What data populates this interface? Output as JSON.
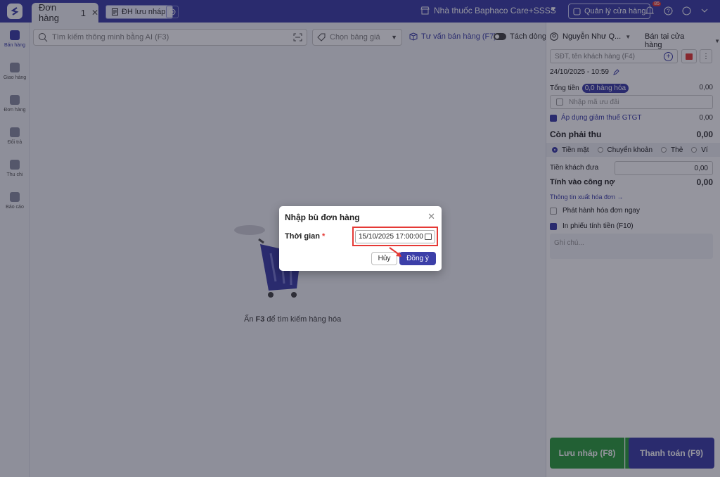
{
  "tabs": {
    "active_label": "Đơn hàng",
    "active_count": "1",
    "close": "✕",
    "draft_label": "ĐH lưu nháp"
  },
  "header": {
    "store_name": "Nhà thuốc Baphaco Care+SSSS",
    "manage_label": "Quản lý cửa hàng",
    "notif_count": "85"
  },
  "sidebar": {
    "items": [
      {
        "label": "Bán hàng",
        "icon": "cart-icon"
      },
      {
        "label": "Giao hàng",
        "icon": "truck-icon"
      },
      {
        "label": "Đơn hàng",
        "icon": "document-icon"
      },
      {
        "label": "Đổi trả",
        "icon": "return-icon"
      },
      {
        "label": "Thu chi",
        "icon": "wallet-icon"
      },
      {
        "label": "Báo cáo",
        "icon": "chart-icon"
      }
    ]
  },
  "main": {
    "search_placeholder": "Tìm kiếm thông minh bằng AI (F3)",
    "price_placeholder": "Chọn bảng giá",
    "consult_label": "Tư vấn bán hàng (F7)",
    "split_label": "Tách dòng",
    "empty_hint_key": "F3",
    "empty_hint_pre": "Ấn ",
    "empty_hint_post": " để tìm kiếm hàng hóa"
  },
  "order": {
    "staff": "Nguyễn Như Q...",
    "channel": "Bán tại cửa hàng",
    "customer_placeholder": "SĐT, tên khách hàng (F4)",
    "datetime": "24/10/2025 - 10:59",
    "total_label": "Tổng tiền",
    "total_items": "0,0 hàng hóa",
    "total_value": "0,00",
    "promo_placeholder": "Nhập mã ưu đãi",
    "vat_label": "Áp dụng giảm thuế GTGT",
    "vat_value": "0,00",
    "due_label": "Còn phải thu",
    "due_value": "0,00",
    "methods": [
      "Tiền mặt",
      "Chuyển khoản",
      "Thẻ",
      "Ví"
    ],
    "cash_label": "Tiền khách đưa",
    "cash_value": "0,00",
    "debt_label": "Tính vào công nợ",
    "debt_value": "0,00",
    "invoice_link": "Thông tin xuất hóa đơn →",
    "issue_invoice": "Phát hành hóa đơn ngay",
    "print_label": "In phiếu tính tiền (F10)",
    "notes_placeholder": "Ghi chú...",
    "save_label": "Lưu nháp (F8)",
    "pay_label": "Thanh toán (F9)"
  },
  "modal": {
    "title": "Nhập bù đơn hàng",
    "time_label": "Thời gian",
    "required_mark": "*",
    "time_value": "15/10/2025 17:00:00",
    "cancel_label": "Hủy",
    "ok_label": "Đồng ý"
  },
  "colors": {
    "brand": "#3c3fa8",
    "save": "#2e9e3f",
    "highlight": "#e53935"
  }
}
